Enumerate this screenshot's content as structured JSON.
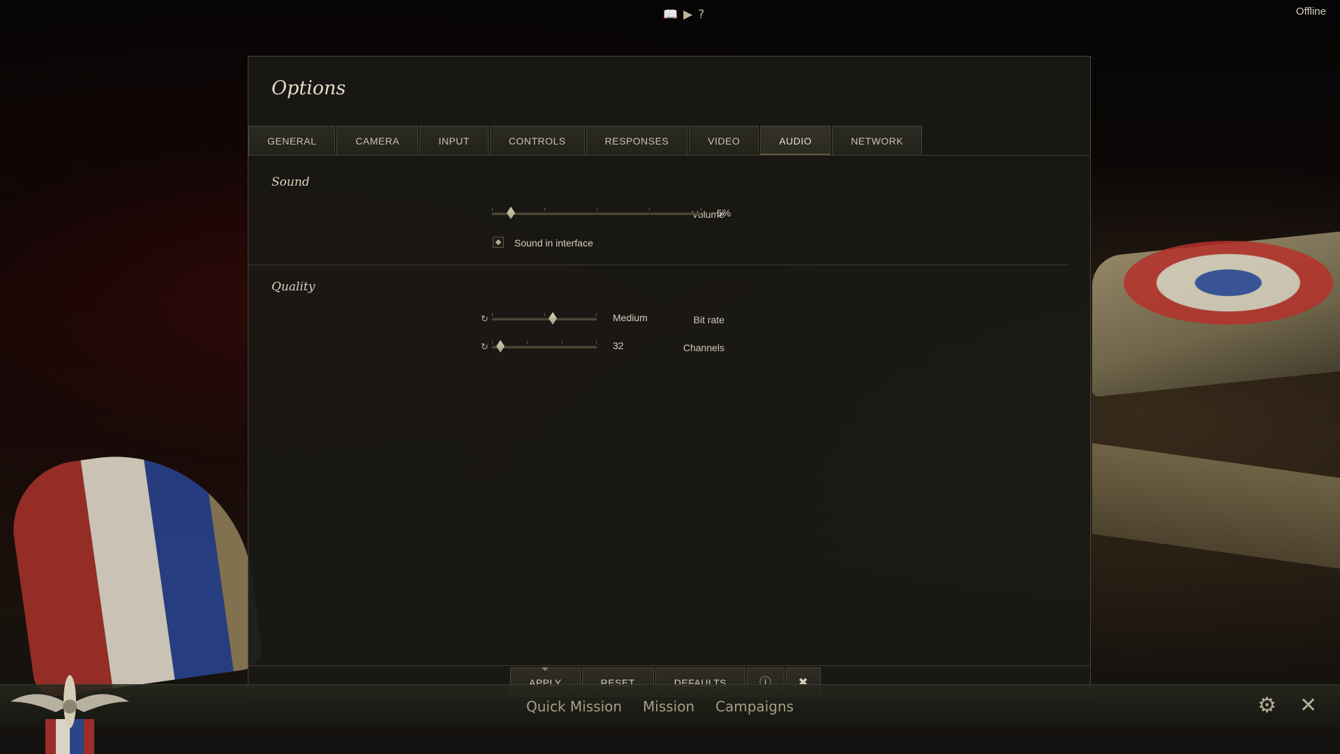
{
  "topbar": {
    "icons": [
      "book-icon",
      "video-icon",
      "help-icon"
    ],
    "status": "Offline"
  },
  "dialog": {
    "title": "Options",
    "tabs": [
      {
        "label": "GENERAL"
      },
      {
        "label": "CAMERA"
      },
      {
        "label": "INPUT"
      },
      {
        "label": "CONTROLS"
      },
      {
        "label": "RESPONSES"
      },
      {
        "label": "VIDEO"
      },
      {
        "label": "AUDIO",
        "active": true
      },
      {
        "label": "NETWORK"
      }
    ],
    "sound": {
      "section_title": "Sound",
      "volume_label": "Volume",
      "volume_value": "5%",
      "volume_fraction": 0.05,
      "sound_in_interface_label": "Sound in interface",
      "sound_in_interface_checked": true
    },
    "quality": {
      "section_title": "Quality",
      "bitrate_label": "Bit rate",
      "bitrate_value": "Medium",
      "bitrate_fraction": 0.5,
      "channels_label": "Channels",
      "channels_value": "32",
      "channels_fraction": 0.0
    },
    "footer": {
      "apply_label": "APPLY",
      "reset_label": "RESET",
      "defaults_label": "DEFAULTS"
    }
  },
  "bottom_nav": {
    "items": [
      "Quick Mission",
      "Mission",
      "Campaigns"
    ]
  },
  "colors": {
    "panel": "#1a1915",
    "accent": "#d9d1b6",
    "text": "#d8d2bd"
  }
}
